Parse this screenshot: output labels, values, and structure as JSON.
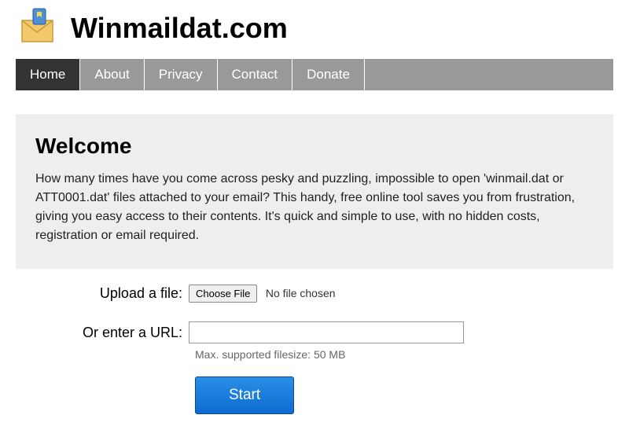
{
  "header": {
    "title": "Winmaildat.com"
  },
  "nav": {
    "items": [
      {
        "label": "Home",
        "active": true
      },
      {
        "label": "About",
        "active": false
      },
      {
        "label": "Privacy",
        "active": false
      },
      {
        "label": "Contact",
        "active": false
      },
      {
        "label": "Donate",
        "active": false
      }
    ]
  },
  "welcome": {
    "title": "Welcome",
    "body": "How many times have you come across pesky and puzzling, impossible to open 'winmail.dat or ATT0001.dat' files attached to your email? This handy, free online tool saves you from frustration, giving you easy access to their contents. It's quick and simple to use, with no hidden costs, registration or email required."
  },
  "form": {
    "upload_label": "Upload a file:",
    "choose_file_label": "Choose File",
    "no_file_text": "No file chosen",
    "url_label": "Or enter a URL:",
    "url_value": "",
    "hint": "Max. supported filesize: 50 MB",
    "start_label": "Start"
  },
  "icons": {
    "logo": "envelope-shield-icon"
  }
}
